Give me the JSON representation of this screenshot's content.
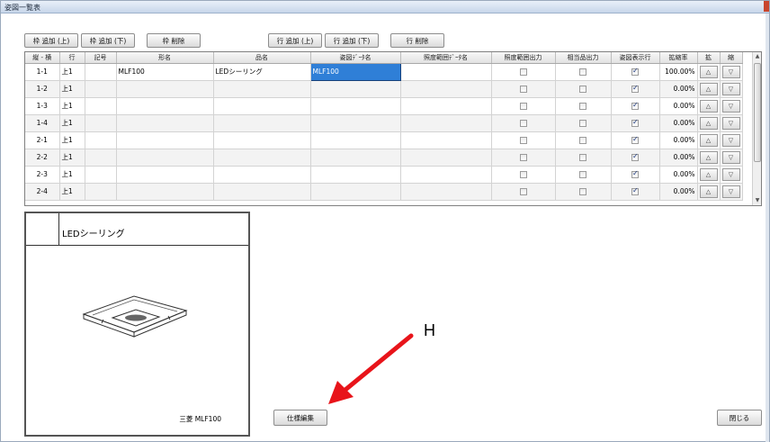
{
  "window": {
    "title": "姿図一覧表"
  },
  "toolbar": {
    "frame_add_above": "枠 追加 (上)",
    "frame_add_below": "枠 追加 (下)",
    "frame_delete": "枠 削除",
    "row_add_above": "行 追加 (上)",
    "row_add_below": "行 追加 (下)",
    "row_delete": "行 削除"
  },
  "grid": {
    "columns": [
      "縦 - 横",
      "行",
      "記号",
      "形名",
      "品名",
      "姿図ﾃﾞｰﾀ名",
      "照度範囲ﾃﾞｰﾀ名",
      "照度範囲出力",
      "相当品出力",
      "姿図表示行",
      "拡縮率",
      "拡",
      "縮"
    ],
    "rows": [
      {
        "pos": "1-1",
        "row": "上1",
        "symbol": "",
        "model": "MLF100",
        "product": "LEDシーリング",
        "figure": "MLF100",
        "illum": "",
        "illum_out": false,
        "equiv_out": false,
        "show_fig": true,
        "scale": "100.00%"
      },
      {
        "pos": "1-2",
        "row": "上1",
        "symbol": "",
        "model": "",
        "product": "",
        "figure": "",
        "illum": "",
        "illum_out": false,
        "equiv_out": false,
        "show_fig": true,
        "scale": "0.00%"
      },
      {
        "pos": "1-3",
        "row": "上1",
        "symbol": "",
        "model": "",
        "product": "",
        "figure": "",
        "illum": "",
        "illum_out": false,
        "equiv_out": false,
        "show_fig": true,
        "scale": "0.00%"
      },
      {
        "pos": "1-4",
        "row": "上1",
        "symbol": "",
        "model": "",
        "product": "",
        "figure": "",
        "illum": "",
        "illum_out": false,
        "equiv_out": false,
        "show_fig": true,
        "scale": "0.00%"
      },
      {
        "pos": "2-1",
        "row": "上1",
        "symbol": "",
        "model": "",
        "product": "",
        "figure": "",
        "illum": "",
        "illum_out": false,
        "equiv_out": false,
        "show_fig": true,
        "scale": "0.00%"
      },
      {
        "pos": "2-2",
        "row": "上1",
        "symbol": "",
        "model": "",
        "product": "",
        "figure": "",
        "illum": "",
        "illum_out": false,
        "equiv_out": false,
        "show_fig": true,
        "scale": "0.00%"
      },
      {
        "pos": "2-3",
        "row": "上1",
        "symbol": "",
        "model": "",
        "product": "",
        "figure": "",
        "illum": "",
        "illum_out": false,
        "equiv_out": false,
        "show_fig": true,
        "scale": "0.00%"
      },
      {
        "pos": "2-4",
        "row": "上1",
        "symbol": "",
        "model": "",
        "product": "",
        "figure": "",
        "illum": "",
        "illum_out": false,
        "equiv_out": false,
        "show_fig": true,
        "scale": "0.00%"
      }
    ],
    "zoom_in_glyph": "△",
    "zoom_out_glyph": "▽"
  },
  "preview": {
    "product_name": "LEDシーリング",
    "maker_model": "三菱 MLF100"
  },
  "buttons": {
    "spec_edit": "仕様編集",
    "close": "閉じる"
  },
  "annotation": {
    "label": "H",
    "color": "#e8141a"
  }
}
